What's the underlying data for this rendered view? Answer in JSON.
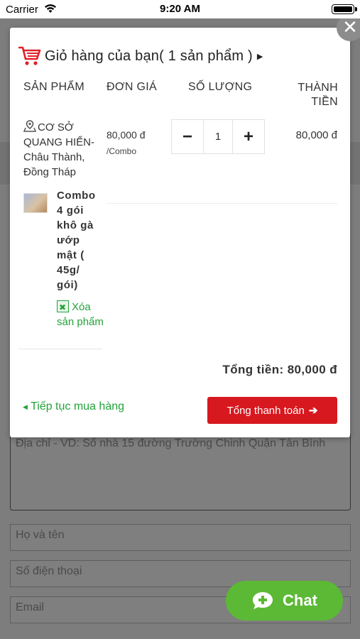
{
  "status_bar": {
    "carrier": "Carrier",
    "time": "9:20 AM"
  },
  "background_form": {
    "address_placeholder": "Địa chỉ - VD: Số nhà 15 đường Trường Chinh Quận Tân Bình",
    "name_placeholder": "Họ và tên",
    "phone_placeholder": "Số điện thoại",
    "email_placeholder": "Email"
  },
  "modal": {
    "close_label": "✕",
    "title": "Giỏ hàng của bạn( 1 sản phẩm )",
    "columns": {
      "product": "SẢN PHẨM",
      "price": "ĐƠN GIÁ",
      "quantity": "SỐ LƯỢNG",
      "total": "THÀNH TIỀN"
    },
    "store": "CƠ SỞ QUANG HIỂN- Châu Thành, Đồng Tháp",
    "item": {
      "name": "Combo 4 gói khô gà ướp mật ( 45g/ gói)",
      "price": "80,000 đ",
      "unit": "/Combo",
      "quantity": "1",
      "line_total": "80,000 đ",
      "remove_label": "Xóa sản phẩm"
    },
    "grand_total": "Tổng tiền: 80,000 đ",
    "continue_label": "Tiếp tục mua hàng",
    "checkout_label": "Tổng thanh toán"
  },
  "chat": {
    "label": "Chat"
  },
  "colors": {
    "accent_green": "#22a33a",
    "checkout_red": "#d7181f",
    "chat_green": "#5cb936",
    "cart_red": "#e0222a"
  }
}
